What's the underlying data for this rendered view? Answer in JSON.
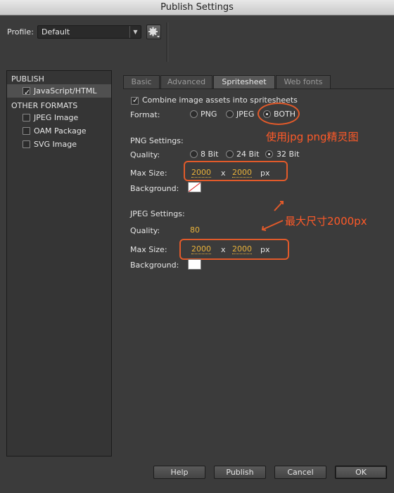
{
  "window": {
    "title": "Publish Settings"
  },
  "profile": {
    "label": "Profile:",
    "value": "Default"
  },
  "left_panel": {
    "publish_header": "PUBLISH",
    "publish_items": [
      {
        "label": "JavaScript/HTML",
        "checked": true
      }
    ],
    "other_header": "OTHER FORMATS",
    "other_items": [
      {
        "label": "JPEG Image",
        "checked": false
      },
      {
        "label": "OAM Package",
        "checked": false
      },
      {
        "label": "SVG Image",
        "checked": false
      }
    ]
  },
  "tabs": [
    "Basic",
    "Advanced",
    "Spritesheet",
    "Web fonts"
  ],
  "active_tab": "Spritesheet",
  "spritesheet": {
    "combine_label": "Combine image assets into spritesheets",
    "format_label": "Format:",
    "format_options": [
      "PNG",
      "JPEG",
      "BOTH"
    ],
    "format_selected": "BOTH",
    "png": {
      "header": "PNG Settings:",
      "quality_label": "Quality:",
      "quality_options": [
        "8 Bit",
        "24 Bit",
        "32 Bit"
      ],
      "quality_selected": "32 Bit",
      "max_size_label": "Max Size:",
      "width": "2000",
      "x": "x",
      "height": "2000",
      "unit": "px",
      "background_label": "Background:"
    },
    "jpeg": {
      "header": "JPEG Settings:",
      "quality_label": "Quality:",
      "quality_value": "80",
      "max_size_label": "Max Size:",
      "width": "2000",
      "x": "x",
      "height": "2000",
      "unit": "px",
      "background_label": "Background:"
    }
  },
  "annotations": {
    "format_note": "使用jpg png精灵图",
    "size_note": "最大尺寸2000px",
    "color": "#e25a2a"
  },
  "buttons": {
    "help": "Help",
    "publish": "Publish",
    "cancel": "Cancel",
    "ok": "OK"
  }
}
